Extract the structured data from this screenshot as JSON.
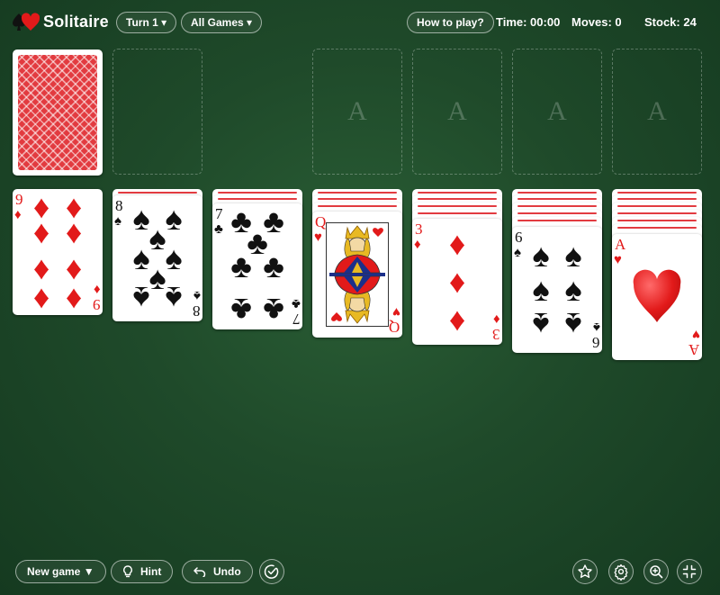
{
  "header": {
    "title": "Solitaire",
    "turn_label": "Turn 1 ▾",
    "games_label": "All Games ▾",
    "help_label": "How to play?",
    "time": "Time: 00:00",
    "moves": "Moves: 0",
    "stock": "Stock: 24"
  },
  "foundations": [
    {
      "placeholder": "A"
    },
    {
      "placeholder": "A"
    },
    {
      "placeholder": "A"
    },
    {
      "placeholder": "A"
    }
  ],
  "tableau": [
    {
      "hidden": 0,
      "face_up": {
        "rank": "9",
        "suit": "diamonds",
        "symbol": "♦",
        "color": "red"
      }
    },
    {
      "hidden": 1,
      "face_up": {
        "rank": "8",
        "suit": "spades",
        "symbol": "♠",
        "color": "black"
      }
    },
    {
      "hidden": 2,
      "face_up": {
        "rank": "7",
        "suit": "clubs",
        "symbol": "♣",
        "color": "black"
      }
    },
    {
      "hidden": 3,
      "face_up": {
        "rank": "Q",
        "suit": "hearts",
        "symbol": "♥",
        "color": "red"
      }
    },
    {
      "hidden": 4,
      "face_up": {
        "rank": "3",
        "suit": "diamonds",
        "symbol": "♦",
        "color": "red"
      }
    },
    {
      "hidden": 5,
      "face_up": {
        "rank": "6",
        "suit": "spades",
        "symbol": "♠",
        "color": "black"
      }
    },
    {
      "hidden": 6,
      "face_up": {
        "rank": "A",
        "suit": "hearts",
        "symbol": "♥",
        "color": "red"
      }
    }
  ],
  "footer": {
    "new_game_label": "New game ▼",
    "hint_label": "Hint",
    "undo_label": "Undo"
  },
  "icons": {
    "logo": "card-suits-logo-icon",
    "hint": "lightbulb-icon",
    "undo": "undo-arrow-icon",
    "auto_complete": "check-circle-icon",
    "favorite": "star-icon",
    "settings": "gear-icon",
    "zoom": "zoom-in-icon",
    "fullscreen": "exit-fullscreen-icon"
  },
  "colors": {
    "table_green": "#1f4a2a",
    "card_red": "#e21a1a",
    "card_back": "#e23b40"
  }
}
